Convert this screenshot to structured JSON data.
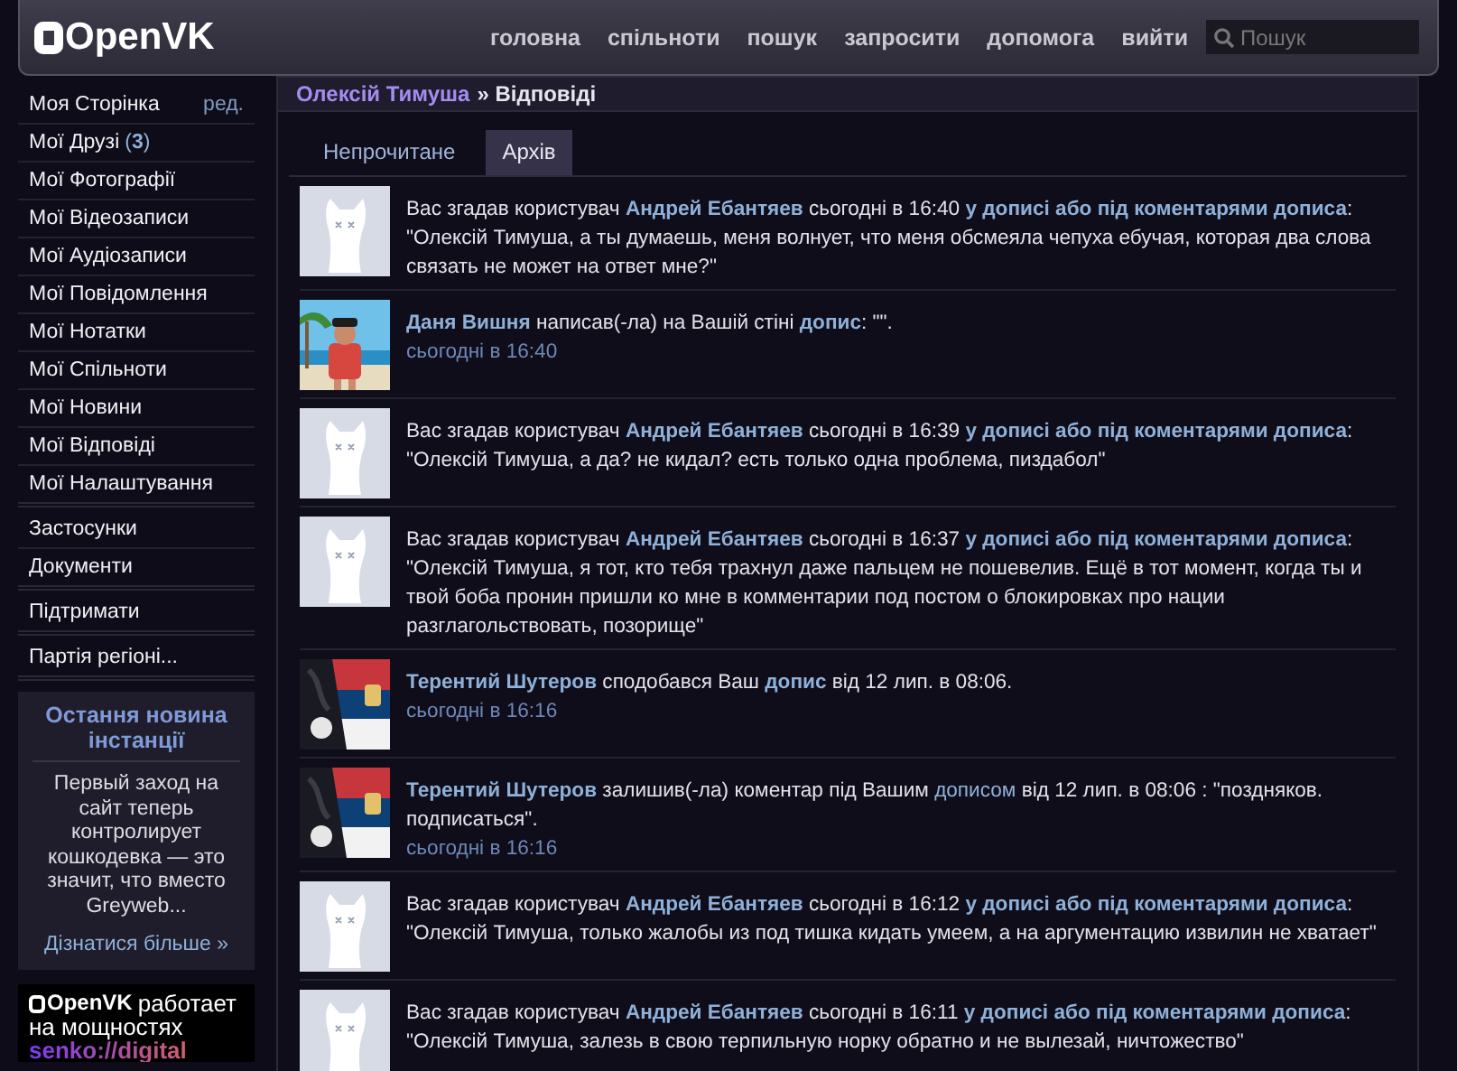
{
  "header": {
    "logo": "OpenVK",
    "nav": [
      "головна",
      "спільноти",
      "пошук",
      "запросити",
      "допомога",
      "вийти"
    ],
    "search": {
      "placeholder": "Пошук"
    }
  },
  "sidebar": {
    "groups": [
      [
        {
          "label": "Моя Сторінка",
          "extra": "ред."
        },
        {
          "label": "Мої Друзі",
          "count": "(**3**)"
        },
        {
          "label": "Мої Фотографії"
        },
        {
          "label": "Мої Відеозаписи"
        },
        {
          "label": "Мої Аудіозаписи"
        },
        {
          "label": "Мої Повідомлення"
        },
        {
          "label": "Мої Нотатки"
        },
        {
          "label": "Мої Спільноти"
        },
        {
          "label": "Мої Новини"
        },
        {
          "label": "Мої Відповіді"
        },
        {
          "label": "Мої Налаштування"
        }
      ],
      [
        {
          "label": "Застосунки"
        },
        {
          "label": "Документи"
        }
      ],
      [
        {
          "label": "Підтримати"
        }
      ],
      [
        {
          "label": "Партія регіоні..."
        }
      ]
    ],
    "news": {
      "title": "Остання новина інстанції",
      "text": "Первый заход на сайт теперь контролирует кошкодевка — это значит, что вместо Greyweb...",
      "link": "Дізнатися більше »"
    },
    "banner": {
      "logo": "OpenVK",
      "lines": [
        "работает",
        "на мощностях",
        "senko://digital"
      ]
    }
  },
  "breadcrumb": {
    "user": "Олексій Тимуша",
    "separator": "»",
    "page": "Відповіді"
  },
  "tabs": [
    {
      "label": "Непрочитане",
      "selected": false
    },
    {
      "label": "Архів",
      "selected": true
    }
  ],
  "notifications": [
    {
      "avatar": {
        "kind": "default"
      },
      "segments": [
        {
          "kind": "plain",
          "text": "Вас згадав користувач "
        },
        {
          "kind": "bold-link",
          "text": "Андрей Ебантяев"
        },
        {
          "kind": "plain",
          "text": " сьогодні в 16:40 "
        },
        {
          "kind": "bold-link",
          "text": "у дописі або під коментарями дописа"
        },
        {
          "kind": "plain",
          "text": ": \"Олексій Тимуша, а ты думаешь, меня волнует, что меня обсмеяла чепуха ебучая, которая два слова связать не может на ответ мне?\""
        }
      ]
    },
    {
      "avatar": {
        "kind": "beach"
      },
      "segments": [
        {
          "kind": "bold-link",
          "text": "Даня Вишня"
        },
        {
          "kind": "plain",
          "text": " написав(-ла) на Вашій стіні "
        },
        {
          "kind": "bold-link",
          "text": "допис"
        },
        {
          "kind": "plain",
          "text": ": \"\"."
        }
      ],
      "time": "сьогодні в 16:40"
    },
    {
      "avatar": {
        "kind": "default"
      },
      "segments": [
        {
          "kind": "plain",
          "text": "Вас згадав користувач "
        },
        {
          "kind": "bold-link",
          "text": "Андрей Ебантяев"
        },
        {
          "kind": "plain",
          "text": " сьогодні в 16:39 "
        },
        {
          "kind": "bold-link",
          "text": "у дописі або під коментарями дописа"
        },
        {
          "kind": "plain",
          "text": ": \"Олексій Тимуша, а да? не кидал? есть только одна проблема, пиздабол\""
        }
      ]
    },
    {
      "avatar": {
        "kind": "default"
      },
      "segments": [
        {
          "kind": "plain",
          "text": "Вас згадав користувач "
        },
        {
          "kind": "bold-link",
          "text": "Андрей Ебантяев"
        },
        {
          "kind": "plain",
          "text": " сьогодні в 16:37 "
        },
        {
          "kind": "bold-link",
          "text": "у дописі або під коментарями дописа"
        },
        {
          "kind": "plain",
          "text": ": \"Олексій Тимуша, я тот, кто тебя трахнул даже пальцем не пошевелив. Ещё в тот момент, когда ты и твой боба пронин пришли ко мне в комментарии под постом о блокировках про нации разглагольствовать, позорище\""
        }
      ]
    },
    {
      "avatar": {
        "kind": "flag"
      },
      "segments": [
        {
          "kind": "bold-link",
          "text": "Терентий Шутеров"
        },
        {
          "kind": "plain",
          "text": " сподобався Ваш "
        },
        {
          "kind": "bold-link",
          "text": "допис"
        },
        {
          "kind": "plain",
          "text": " від 12 лип. в 08:06."
        }
      ],
      "time": "сьогодні в 16:16"
    },
    {
      "avatar": {
        "kind": "flag"
      },
      "segments": [
        {
          "kind": "bold-link",
          "text": "Терентий Шутеров"
        },
        {
          "kind": "plain",
          "text": " залишив(-ла) коментар під Вашим "
        },
        {
          "kind": "link",
          "text": "дописом"
        },
        {
          "kind": "plain",
          "text": " від 12 лип. в 08:06 : \"поздняков. подписаться\"."
        }
      ],
      "time": "сьогодні в 16:16"
    },
    {
      "avatar": {
        "kind": "default"
      },
      "segments": [
        {
          "kind": "plain",
          "text": "Вас згадав користувач "
        },
        {
          "kind": "bold-link",
          "text": "Андрей Ебантяев"
        },
        {
          "kind": "plain",
          "text": " сьогодні в 16:12 "
        },
        {
          "kind": "bold-link",
          "text": "у дописі або під коментарями дописа"
        },
        {
          "kind": "plain",
          "text": ": \"Олексій Тимуша, только жалобы из под тишка кидать умеем, а на аргументацию извилин не хватает\""
        }
      ]
    },
    {
      "avatar": {
        "kind": "default"
      },
      "segments": [
        {
          "kind": "plain",
          "text": "Вас згадав користувач "
        },
        {
          "kind": "bold-link",
          "text": "Андрей Ебантяев"
        },
        {
          "kind": "plain",
          "text": " сьогодні в 16:11 "
        },
        {
          "kind": "bold-link",
          "text": "у дописі або під коментарями дописа"
        },
        {
          "kind": "plain",
          "text": ": \"Олексій Тимуша, залезь в свою терпильную норку обратно и не вылезай, ничтожество\""
        }
      ]
    }
  ]
}
